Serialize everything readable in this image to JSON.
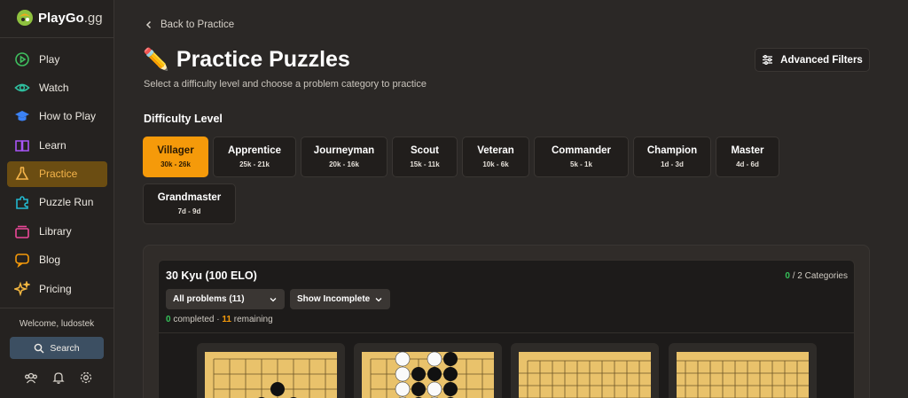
{
  "brand": {
    "name": "PlayGo",
    "suffix": ".gg"
  },
  "sidebar": {
    "items": [
      {
        "label": "Play",
        "icon": "play-icon",
        "active": false
      },
      {
        "label": "Watch",
        "icon": "eye-icon",
        "active": false
      },
      {
        "label": "How to Play",
        "icon": "graduation-cap-icon",
        "active": false
      },
      {
        "label": "Learn",
        "icon": "book-icon",
        "active": false
      },
      {
        "label": "Practice",
        "icon": "flask-icon",
        "active": true
      },
      {
        "label": "Puzzle Run",
        "icon": "puzzle-icon",
        "active": false
      },
      {
        "label": "Library",
        "icon": "library-icon",
        "active": false
      },
      {
        "label": "Blog",
        "icon": "chat-icon",
        "active": false
      },
      {
        "label": "Pricing",
        "icon": "sparkles-icon",
        "active": false
      }
    ],
    "welcome": "Welcome, ludostek",
    "search_label": "Search",
    "bottom_icons": [
      "friends-icon",
      "bell-icon",
      "gear-icon"
    ]
  },
  "header": {
    "back_label": "Back to Practice",
    "title_emoji": "✏️",
    "title": "Practice Puzzles",
    "subtitle": "Select a difficulty level and choose a problem category to practice",
    "advanced_filters_label": "Advanced Filters"
  },
  "difficulty": {
    "label": "Difficulty Level",
    "levels": [
      {
        "name": "Villager",
        "range": "30k - 26k",
        "active": true
      },
      {
        "name": "Apprentice",
        "range": "25k - 21k",
        "active": false
      },
      {
        "name": "Journeyman",
        "range": "20k - 16k",
        "active": false
      },
      {
        "name": "Scout",
        "range": "15k - 11k",
        "active": false
      },
      {
        "name": "Veteran",
        "range": "10k - 6k",
        "active": false
      },
      {
        "name": "Commander",
        "range": "5k - 1k",
        "active": false
      },
      {
        "name": "Champion",
        "range": "1d - 3d",
        "active": false
      },
      {
        "name": "Master",
        "range": "4d - 6d",
        "active": false
      },
      {
        "name": "Grandmaster",
        "range": "7d - 9d",
        "active": false
      }
    ]
  },
  "panel": {
    "title": "30 Kyu (100 ELO)",
    "categories_done": "0",
    "categories_total": "/ 2 Categories",
    "filter_select": "All problems (11)",
    "status_select": "Show Incomplete",
    "completed_count": "0",
    "completed_text": "completed ·",
    "remaining_count": "11",
    "remaining_text": "remaining"
  },
  "colors": {
    "accent": "#f59a0a",
    "active_nav_bg": "#6b4d12",
    "success": "#35c159",
    "board": "#e9c26b"
  }
}
